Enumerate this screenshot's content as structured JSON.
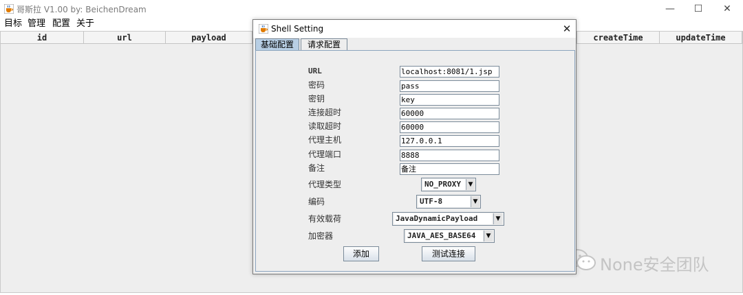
{
  "window": {
    "title": "哥斯拉 V1.00    by: BeichenDream",
    "minimize": "—",
    "maximize": "☐",
    "close": "✕"
  },
  "menu": {
    "items": [
      "目标",
      "管理",
      "配置",
      "关于"
    ]
  },
  "table": {
    "columns": [
      "id",
      "url",
      "payload",
      "createTime",
      "updateTime"
    ]
  },
  "watermark": {
    "text": "None安全团队"
  },
  "dialog": {
    "title": "Shell Setting",
    "close": "✕",
    "tabs": [
      "基础配置",
      "请求配置"
    ],
    "fields": [
      {
        "label": "URL",
        "value": "localhost:8081/1.jsp"
      },
      {
        "label": "密码",
        "value": "pass"
      },
      {
        "label": "密钥",
        "value": "key"
      },
      {
        "label": "连接超时",
        "value": "60000"
      },
      {
        "label": "读取超时",
        "value": "60000"
      },
      {
        "label": "代理主机",
        "value": "127.0.0.1"
      },
      {
        "label": "代理端口",
        "value": "8888"
      },
      {
        "label": "备注",
        "value": "备注"
      }
    ],
    "combos": [
      {
        "label": "代理类型",
        "value": "NO_PROXY"
      },
      {
        "label": "编码",
        "value": "UTF-8"
      },
      {
        "label": "有效载荷",
        "value": "JavaDynamicPayload"
      },
      {
        "label": "加密器",
        "value": "JAVA_AES_BASE64"
      }
    ],
    "buttons": {
      "add": "添加",
      "test": "测试连接"
    }
  }
}
